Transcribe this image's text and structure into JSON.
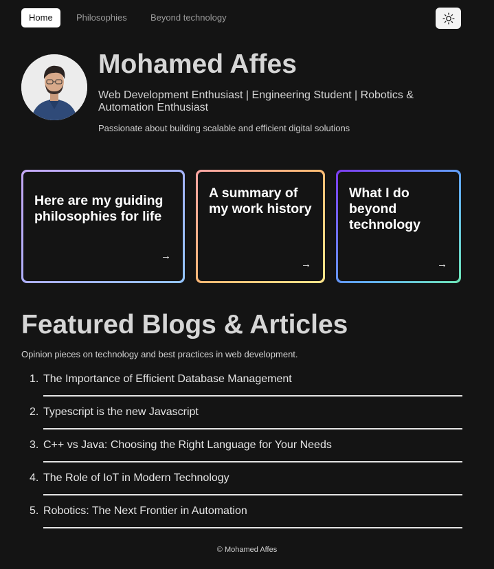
{
  "nav": {
    "items": [
      {
        "label": "Home",
        "active": true
      },
      {
        "label": "Philosophies",
        "active": false
      },
      {
        "label": "Beyond technology",
        "active": false
      }
    ],
    "theme_toggle_icon": "sun-icon"
  },
  "hero": {
    "avatar_icon": "profile-photo",
    "name": "Mohamed Affes",
    "tagline": "Web Development Enthusiast | Engineering Student | Robotics & Automation Enthusiast",
    "description": "Passionate about building scalable and efficient digital solutions"
  },
  "cards": [
    {
      "title": "Here are my guiding philosophies for life",
      "arrow": "→"
    },
    {
      "title": "A summary of my work history",
      "arrow": "→"
    },
    {
      "title": "What I do beyond technology",
      "arrow": "→"
    }
  ],
  "blogs": {
    "title": "Featured Blogs & Articles",
    "subtitle": "Opinion pieces on technology and best practices in web development.",
    "items": [
      {
        "num": "1.",
        "title": "The Importance of Efficient Database Management"
      },
      {
        "num": "2.",
        "title": "Typescript is the new Javascript"
      },
      {
        "num": "3.",
        "title": "C++ vs Java: Choosing the Right Language for Your Needs"
      },
      {
        "num": "4.",
        "title": "The Role of IoT in Modern Technology"
      },
      {
        "num": "5.",
        "title": "Robotics: The Next Frontier in Automation"
      }
    ]
  },
  "footer": {
    "text": "© Mohamed Affes"
  },
  "colors": {
    "background": "#141414",
    "text": "#e5e5e5",
    "nav_active_bg": "#ffffff"
  }
}
